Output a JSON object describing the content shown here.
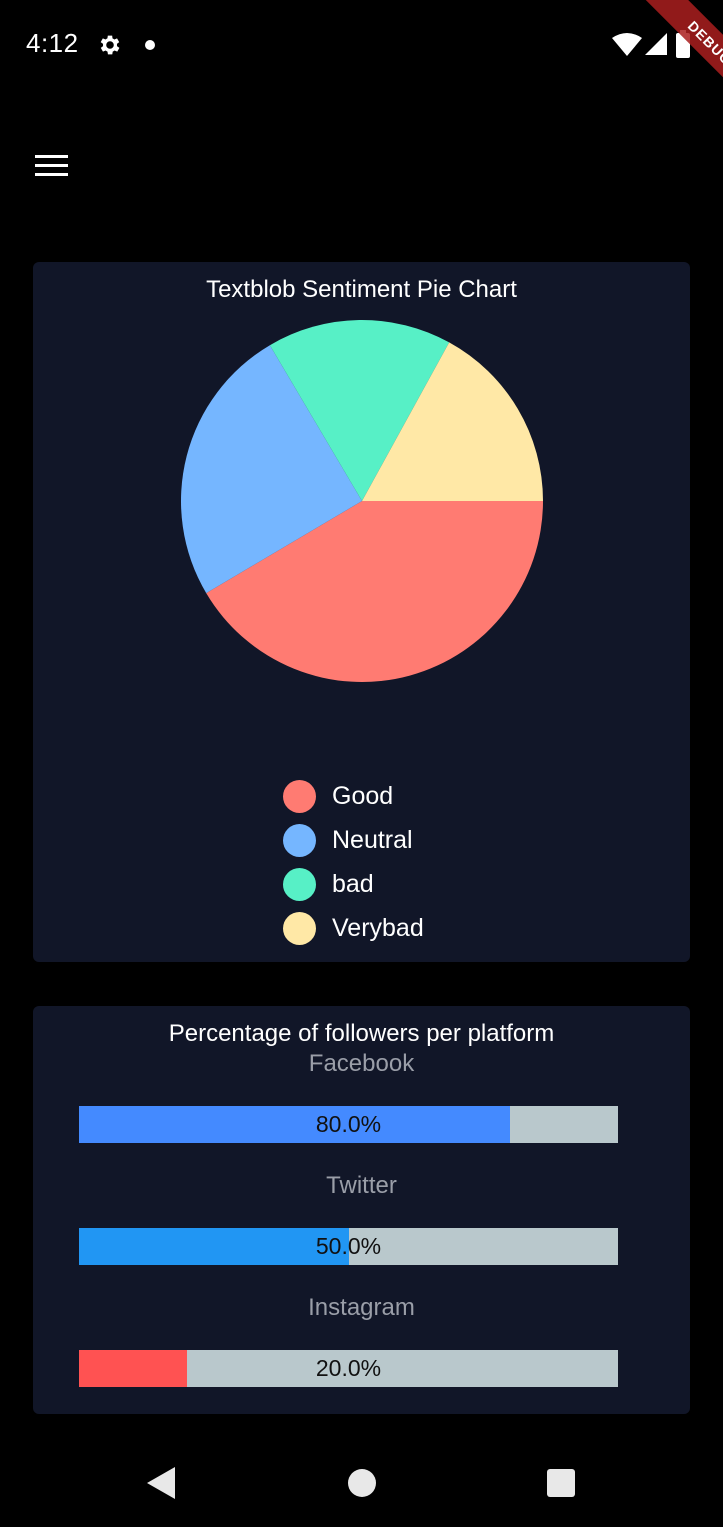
{
  "status_bar": {
    "time": "4:12",
    "icons": [
      "gear-icon",
      "notification-dot-icon",
      "wifi-icon",
      "signal-icon",
      "battery-icon"
    ]
  },
  "debug_banner": "DEBUG",
  "app_bar": {
    "menu_icon": "hamburger-menu-icon"
  },
  "pie_card": {
    "title": "Textblob Sentiment Pie Chart"
  },
  "followers_card": {
    "title": "Percentage of followers per platform",
    "platforms": [
      {
        "name": "Facebook",
        "percent_label": "80.0%",
        "fraction": 0.8,
        "color": "#448aff"
      },
      {
        "name": "Twitter",
        "percent_label": "50.0%",
        "fraction": 0.5,
        "color": "#2196f3"
      },
      {
        "name": "Instagram",
        "percent_label": "20.0%",
        "fraction": 0.2,
        "color": "#ff5252"
      }
    ],
    "track_color": "#b9c8cc"
  },
  "nav_bar": {
    "icons": [
      "back-icon",
      "home-icon",
      "recent-apps-icon"
    ]
  },
  "chart_data": {
    "type": "pie",
    "title": "Textblob Sentiment Pie Chart",
    "categories": [
      "Good",
      "Neutral",
      "bad",
      "Verybad"
    ],
    "values": [
      41.5,
      25,
      16.5,
      17
    ],
    "colors": [
      "#ff7b72",
      "#75b6ff",
      "#57f0c6",
      "#ffe8a6"
    ],
    "legend": "bottom-center"
  }
}
